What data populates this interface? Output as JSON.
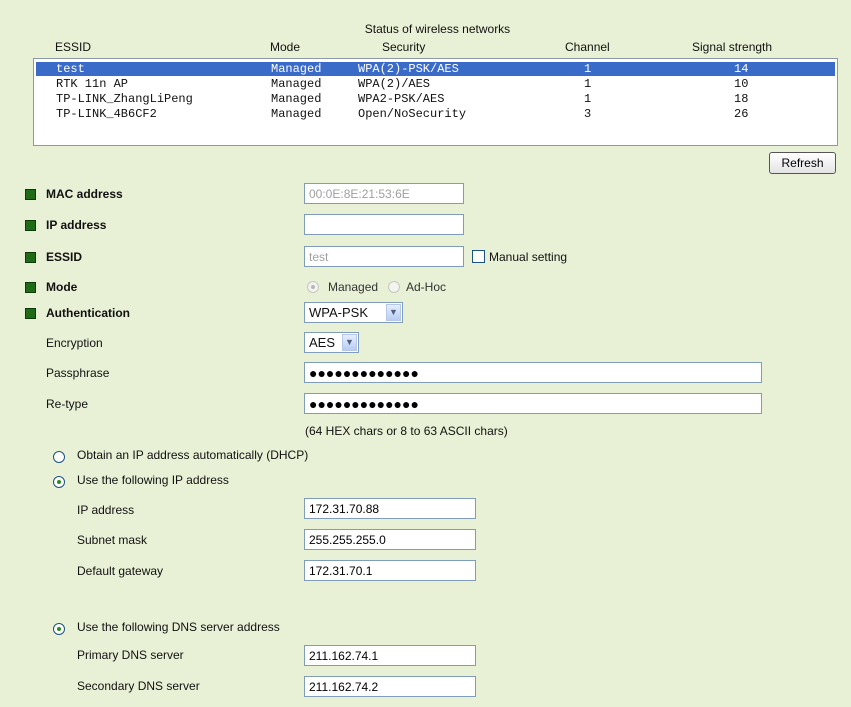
{
  "networks": {
    "title": "Status of wireless networks",
    "columns": [
      "ESSID",
      "Mode",
      "Security",
      "Channel",
      "Signal strength"
    ],
    "rows": [
      {
        "essid": "test",
        "mode": "Managed",
        "security": "WPA(2)-PSK/AES",
        "channel": "1",
        "signal": "14",
        "selected": true
      },
      {
        "essid": "RTK 11n AP",
        "mode": "Managed",
        "security": "WPA(2)/AES",
        "channel": "1",
        "signal": "10",
        "selected": false
      },
      {
        "essid": "TP-LINK_ZhangLiPeng",
        "mode": "Managed",
        "security": "WPA2-PSK/AES",
        "channel": "1",
        "signal": "18",
        "selected": false
      },
      {
        "essid": "TP-LINK_4B6CF2",
        "mode": "Managed",
        "security": "Open/NoSecurity",
        "channel": "3",
        "signal": "26",
        "selected": false
      }
    ],
    "refresh_label": "Refresh"
  },
  "form": {
    "mac_label": "MAC address",
    "mac_value": "00:0E:8E:21:53:6E",
    "ip_label": "IP address",
    "ip_value": "",
    "essid_label": "ESSID",
    "essid_value": "test",
    "manual_setting_label": "Manual setting",
    "mode_label": "Mode",
    "mode_managed": "Managed",
    "mode_adhoc": "Ad-Hoc",
    "auth_label": "Authentication",
    "auth_value": "WPA-PSK",
    "enc_label": "Encryption",
    "enc_value": "AES",
    "pass_label": "Passphrase",
    "pass_value": "●●●●●●●●●●●●●",
    "retype_label": "Re-type",
    "retype_value": "●●●●●●●●●●●●●",
    "pass_hint": "(64 HEX chars or 8 to 63 ASCII chars)"
  },
  "ip_config": {
    "dhcp_label": "Obtain an IP address automatically (DHCP)",
    "static_label": "Use the following IP address",
    "ip_label": "IP address",
    "ip_value": "172.31.70.88",
    "mask_label": "Subnet mask",
    "mask_value": "255.255.255.0",
    "gw_label": "Default gateway",
    "gw_value": "172.31.70.1"
  },
  "dns": {
    "static_label": "Use the following DNS server address",
    "primary_label": "Primary DNS server",
    "primary_value": "211.162.74.1",
    "secondary_label": "Secondary DNS server",
    "secondary_value": "211.162.74.2"
  },
  "colors": {
    "background": "#e8f1d6",
    "selection": "#3a6bc8",
    "bullet": "#1f6b16"
  }
}
